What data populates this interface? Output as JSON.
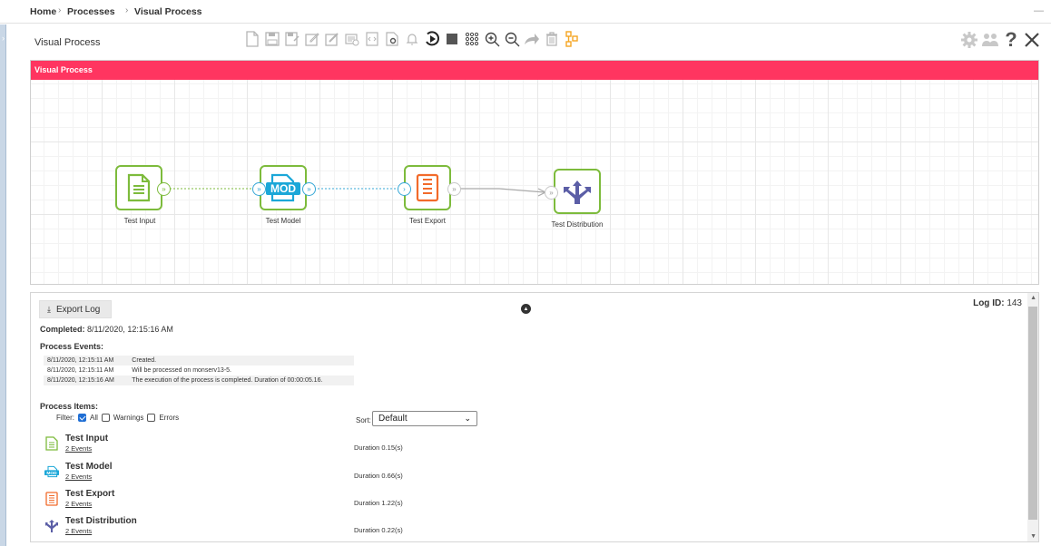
{
  "breadcrumb": {
    "home": "Home",
    "processes": "Processes",
    "current": "Visual Process",
    "separator": "›",
    "collapse": "—"
  },
  "header": {
    "title": "Visual Process"
  },
  "toolbar": {
    "icons": [
      "new-document-icon",
      "save-icon",
      "save-as-icon",
      "edit-properties-icon",
      "edit-icon",
      "schedule-icon",
      "code-icon",
      "settings-document-icon",
      "notification-bell-icon",
      "run-icon",
      "stop-icon",
      "grid-icon",
      "zoom-in-icon",
      "zoom-out-icon",
      "share-arrow-icon",
      "delete-icon",
      "layout-icon"
    ],
    "right_icons": [
      "gear-icon",
      "users-icon",
      "help-icon",
      "close-icon"
    ]
  },
  "canvas": {
    "title": "Visual Process",
    "nodes": [
      {
        "label": "Test Input",
        "icon": "document-lines-icon",
        "icon_color": "#7dbb3c"
      },
      {
        "label": "Test Model",
        "icon": "mod-icon",
        "icon_color": "#1ba7d8",
        "icon_text": "MOD"
      },
      {
        "label": "Test Export",
        "icon": "export-list-icon",
        "icon_color": "#f26b2b"
      },
      {
        "label": "Test Distribution",
        "icon": "distribution-arrows-icon",
        "icon_color": "#5b5ea6"
      }
    ]
  },
  "log": {
    "export_button": "Export Log",
    "log_id_label": "Log ID:",
    "log_id": "143",
    "completed_label": "Completed:",
    "completed_value": "8/11/2020, 12:15:16 AM",
    "process_events_heading": "Process Events:",
    "events": [
      {
        "time": "8/11/2020, 12:15:11 AM",
        "message": "Created."
      },
      {
        "time": "8/11/2020, 12:15:11 AM",
        "message": "Will be processed on monserv13-5."
      },
      {
        "time": "8/11/2020, 12:15:16 AM",
        "message": "The execution of the process is completed. Duration of 00:00:05.16."
      }
    ],
    "process_items_heading": "Process Items:",
    "filter": {
      "label": "Filter:",
      "all": "All",
      "warnings": "Warnings",
      "errors": "Errors",
      "all_checked": true,
      "warnings_checked": false,
      "errors_checked": false
    },
    "sort": {
      "label": "Sort:",
      "value": "Default"
    },
    "items": [
      {
        "name": "Test Input",
        "events": "2 Events",
        "duration": "Duration 0.15(s)",
        "icon": "document-lines-icon"
      },
      {
        "name": "Test Model",
        "events": "2 Events",
        "duration": "Duration 0.66(s)",
        "icon": "mod-icon"
      },
      {
        "name": "Test Export",
        "events": "2 Events",
        "duration": "Duration 1.22(s)",
        "icon": "export-list-icon"
      },
      {
        "name": "Test Distribution",
        "events": "2 Events",
        "duration": "Duration 0.22(s)",
        "icon": "distribution-arrows-icon"
      }
    ]
  },
  "colors": {
    "accent": "#ff3560",
    "node_border": "#7dbb3c",
    "toolbar_icon": "#b5b5b5",
    "toolbar_active": "#333333",
    "toolbar_orange": "#f5a623"
  }
}
